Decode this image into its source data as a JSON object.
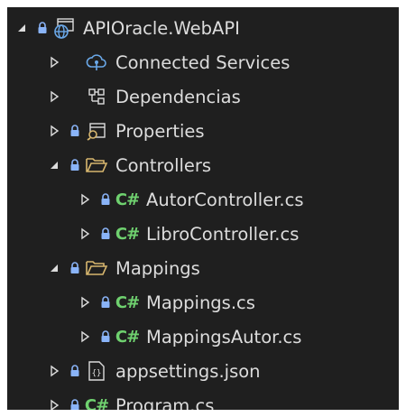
{
  "solution_explorer": {
    "items": [
      {
        "label": "APIOracle.WebAPI",
        "icon": "web-project-icon",
        "expanded": true
      },
      {
        "label": "Connected Services",
        "icon": "connected-services-icon"
      },
      {
        "label": "Dependencias",
        "icon": "dependencies-icon"
      },
      {
        "label": "Properties",
        "icon": "properties-folder-icon"
      },
      {
        "label": "Controllers",
        "icon": "folder-open-icon",
        "expanded": true
      },
      {
        "label": "AutorController.cs",
        "icon": "csharp-file-icon",
        "badge": "C#"
      },
      {
        "label": "LibroController.cs",
        "icon": "csharp-file-icon",
        "badge": "C#"
      },
      {
        "label": "Mappings",
        "icon": "folder-open-icon",
        "expanded": true
      },
      {
        "label": "Mappings.cs",
        "icon": "csharp-file-icon",
        "badge": "C#"
      },
      {
        "label": "MappingsAutor.cs",
        "icon": "csharp-file-icon",
        "badge": "C#"
      },
      {
        "label": "appsettings.json",
        "icon": "json-file-icon"
      },
      {
        "label": "Program.cs",
        "icon": "csharp-file-icon",
        "badge": "C#"
      }
    ]
  },
  "colors": {
    "background": "#1f1f1f",
    "text": "#dcdcdc",
    "csharp": "#6fd16f",
    "lock": "#8ab4f8",
    "folder": "#d7b66e"
  }
}
